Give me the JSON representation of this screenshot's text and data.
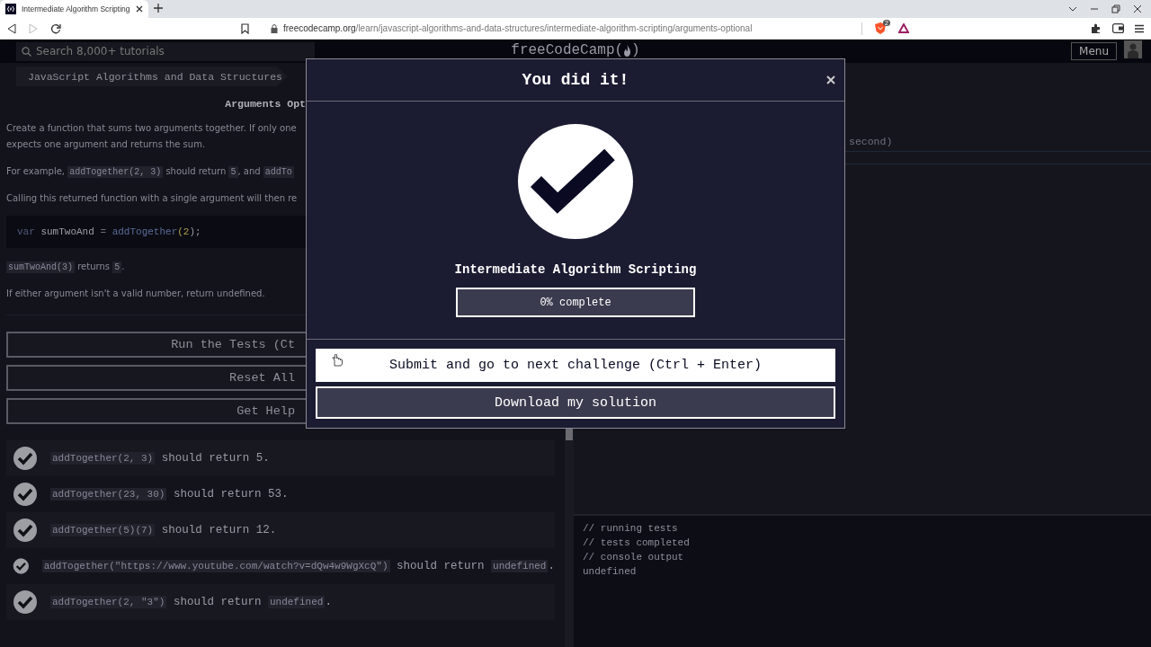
{
  "browser": {
    "tab_title": "Intermediate Algorithm Scripting",
    "url_domain": "freecodecamp.org",
    "url_path": "/learn/javascript-algorithms-and-data-structures/intermediate-algorithm-scripting/arguments-optional",
    "shield_count": "2"
  },
  "nav": {
    "search_placeholder": "Search 8,000+ tutorials",
    "logo": "freeCodeCamp(",
    "logo_close": ")",
    "menu": "Menu"
  },
  "challenge": {
    "breadcrumb": "JavaScript Algorithms and Data Structures",
    "title": "Arguments Opt",
    "paragraphs": [
      [
        {
          "kind": "text",
          "text": "Create a function that sums two arguments together. If only one\nexpects one argument and returns the sum."
        }
      ],
      [
        {
          "kind": "text",
          "text": "For example, "
        },
        {
          "kind": "code",
          "text": "addTogether(2, 3)"
        },
        {
          "kind": "text",
          "text": " should return "
        },
        {
          "kind": "code",
          "text": "5"
        },
        {
          "kind": "text",
          "text": ", and "
        },
        {
          "kind": "code",
          "text": "addTo"
        }
      ],
      [
        {
          "kind": "text",
          "text": "Calling this returned function with a single argument will then re"
        }
      ],
      [
        {
          "kind": "codeblock",
          "tokens": [
            {
              "kind": "keyword",
              "text": "var "
            },
            {
              "kind": "plain",
              "text": "sumTwoAnd "
            },
            {
              "kind": "operator",
              "text": "= "
            },
            {
              "kind": "function",
              "text": "addTogether"
            },
            {
              "kind": "paren",
              "text": "(2"
            },
            {
              "kind": "plain",
              "text": ");"
            }
          ]
        }
      ],
      [
        {
          "kind": "code",
          "text": "sumTwoAnd(3)"
        },
        {
          "kind": "text",
          "text": " returns "
        },
        {
          "kind": "code",
          "text": "5"
        },
        {
          "kind": "text",
          "text": "."
        }
      ],
      [
        {
          "kind": "text",
          "text": "If either argument isn't a valid number, return undefined."
        }
      ]
    ],
    "buttons": [
      "Run the Tests (Ct",
      "Reset All",
      "Get Help"
    ],
    "tests": [
      {
        "passed": true,
        "parts": [
          {
            "kind": "code",
            "text": "addTogether(2, 3)"
          },
          {
            "kind": "text",
            "text": " should return 5."
          }
        ]
      },
      {
        "passed": true,
        "parts": [
          {
            "kind": "code",
            "text": "addTogether(23, 30)"
          },
          {
            "kind": "text",
            "text": " should return 53."
          }
        ]
      },
      {
        "passed": true,
        "parts": [
          {
            "kind": "code",
            "text": "addTogether(5)(7)"
          },
          {
            "kind": "text",
            "text": " should return 12."
          }
        ]
      },
      {
        "passed": true,
        "parts": [
          {
            "kind": "code",
            "text": "addTogether(\"https://www.youtube.com/watch?v=dQw4w9WgXcQ\")"
          },
          {
            "kind": "text",
            "text": " should return "
          },
          {
            "kind": "code",
            "text": "undefined"
          },
          {
            "kind": "text",
            "text": "."
          }
        ]
      },
      {
        "passed": true,
        "parts": [
          {
            "kind": "code",
            "text": "addTogether(2, \"3\")"
          },
          {
            "kind": "text",
            "text": " should return "
          },
          {
            "kind": "code",
            "text": "undefined"
          },
          {
            "kind": "text",
            "text": "."
          }
        ]
      }
    ]
  },
  "editor": {
    "code_fragment": "second)",
    "console": [
      "// running tests",
      "// tests completed",
      "// console output",
      "undefined"
    ]
  },
  "modal": {
    "title": "You did it!",
    "cert_title": "Intermediate Algorithm Scripting",
    "progress": {
      "label": "0% complete",
      "level": 0
    },
    "buttons": [
      {
        "label": "Submit and go to next challenge (Ctrl + Enter)",
        "kind": "primary"
      },
      {
        "label": "Download my solution",
        "kind": "secondary"
      }
    ]
  }
}
